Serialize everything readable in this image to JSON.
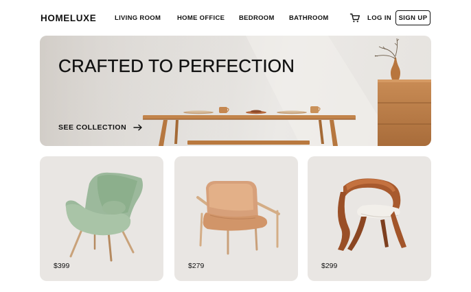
{
  "header": {
    "logo": "HOMELUXE",
    "nav": [
      "LIVING ROOM",
      "HOME OFFICE",
      "BEDROOM",
      "BATHROOM"
    ],
    "cart_icon": "cart-icon",
    "login_label": "LOG IN",
    "signup_label": "SIGN UP"
  },
  "hero": {
    "title": "CRAFTED TO PERFECTION",
    "cta_label": "SEE COLLECTION",
    "cta_icon": "arrow-right-icon"
  },
  "products": [
    {
      "price": "$399",
      "image": "green-wingback-chair"
    },
    {
      "price": "$279",
      "image": "tan-leather-armchair"
    },
    {
      "price": "$299",
      "image": "walnut-bentwood-chair"
    }
  ],
  "colors": {
    "text": "#111111",
    "card_bg": "#e9e6e3",
    "wood": "#b57a45"
  }
}
